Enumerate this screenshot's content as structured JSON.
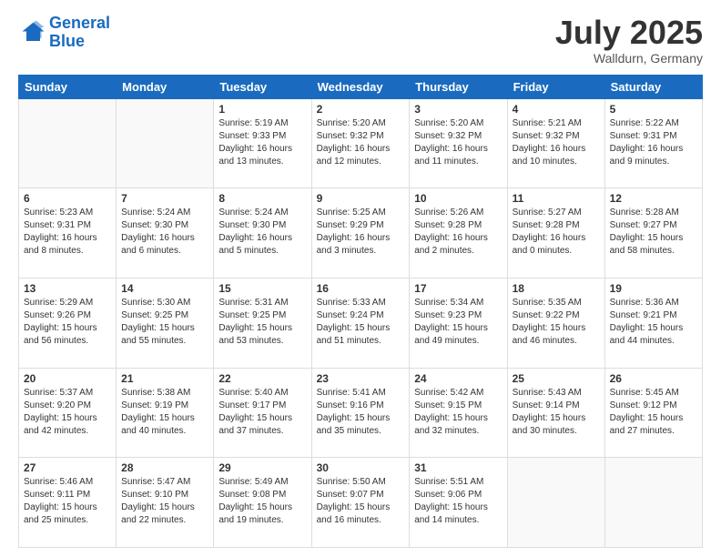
{
  "header": {
    "logo_line1": "General",
    "logo_line2": "Blue",
    "month_year": "July 2025",
    "location": "Walldurn, Germany"
  },
  "weekdays": [
    "Sunday",
    "Monday",
    "Tuesday",
    "Wednesday",
    "Thursday",
    "Friday",
    "Saturday"
  ],
  "weeks": [
    [
      {
        "day": "",
        "info": ""
      },
      {
        "day": "",
        "info": ""
      },
      {
        "day": "1",
        "info": "Sunrise: 5:19 AM\nSunset: 9:33 PM\nDaylight: 16 hours\nand 13 minutes."
      },
      {
        "day": "2",
        "info": "Sunrise: 5:20 AM\nSunset: 9:32 PM\nDaylight: 16 hours\nand 12 minutes."
      },
      {
        "day": "3",
        "info": "Sunrise: 5:20 AM\nSunset: 9:32 PM\nDaylight: 16 hours\nand 11 minutes."
      },
      {
        "day": "4",
        "info": "Sunrise: 5:21 AM\nSunset: 9:32 PM\nDaylight: 16 hours\nand 10 minutes."
      },
      {
        "day": "5",
        "info": "Sunrise: 5:22 AM\nSunset: 9:31 PM\nDaylight: 16 hours\nand 9 minutes."
      }
    ],
    [
      {
        "day": "6",
        "info": "Sunrise: 5:23 AM\nSunset: 9:31 PM\nDaylight: 16 hours\nand 8 minutes."
      },
      {
        "day": "7",
        "info": "Sunrise: 5:24 AM\nSunset: 9:30 PM\nDaylight: 16 hours\nand 6 minutes."
      },
      {
        "day": "8",
        "info": "Sunrise: 5:24 AM\nSunset: 9:30 PM\nDaylight: 16 hours\nand 5 minutes."
      },
      {
        "day": "9",
        "info": "Sunrise: 5:25 AM\nSunset: 9:29 PM\nDaylight: 16 hours\nand 3 minutes."
      },
      {
        "day": "10",
        "info": "Sunrise: 5:26 AM\nSunset: 9:28 PM\nDaylight: 16 hours\nand 2 minutes."
      },
      {
        "day": "11",
        "info": "Sunrise: 5:27 AM\nSunset: 9:28 PM\nDaylight: 16 hours\nand 0 minutes."
      },
      {
        "day": "12",
        "info": "Sunrise: 5:28 AM\nSunset: 9:27 PM\nDaylight: 15 hours\nand 58 minutes."
      }
    ],
    [
      {
        "day": "13",
        "info": "Sunrise: 5:29 AM\nSunset: 9:26 PM\nDaylight: 15 hours\nand 56 minutes."
      },
      {
        "day": "14",
        "info": "Sunrise: 5:30 AM\nSunset: 9:25 PM\nDaylight: 15 hours\nand 55 minutes."
      },
      {
        "day": "15",
        "info": "Sunrise: 5:31 AM\nSunset: 9:25 PM\nDaylight: 15 hours\nand 53 minutes."
      },
      {
        "day": "16",
        "info": "Sunrise: 5:33 AM\nSunset: 9:24 PM\nDaylight: 15 hours\nand 51 minutes."
      },
      {
        "day": "17",
        "info": "Sunrise: 5:34 AM\nSunset: 9:23 PM\nDaylight: 15 hours\nand 49 minutes."
      },
      {
        "day": "18",
        "info": "Sunrise: 5:35 AM\nSunset: 9:22 PM\nDaylight: 15 hours\nand 46 minutes."
      },
      {
        "day": "19",
        "info": "Sunrise: 5:36 AM\nSunset: 9:21 PM\nDaylight: 15 hours\nand 44 minutes."
      }
    ],
    [
      {
        "day": "20",
        "info": "Sunrise: 5:37 AM\nSunset: 9:20 PM\nDaylight: 15 hours\nand 42 minutes."
      },
      {
        "day": "21",
        "info": "Sunrise: 5:38 AM\nSunset: 9:19 PM\nDaylight: 15 hours\nand 40 minutes."
      },
      {
        "day": "22",
        "info": "Sunrise: 5:40 AM\nSunset: 9:17 PM\nDaylight: 15 hours\nand 37 minutes."
      },
      {
        "day": "23",
        "info": "Sunrise: 5:41 AM\nSunset: 9:16 PM\nDaylight: 15 hours\nand 35 minutes."
      },
      {
        "day": "24",
        "info": "Sunrise: 5:42 AM\nSunset: 9:15 PM\nDaylight: 15 hours\nand 32 minutes."
      },
      {
        "day": "25",
        "info": "Sunrise: 5:43 AM\nSunset: 9:14 PM\nDaylight: 15 hours\nand 30 minutes."
      },
      {
        "day": "26",
        "info": "Sunrise: 5:45 AM\nSunset: 9:12 PM\nDaylight: 15 hours\nand 27 minutes."
      }
    ],
    [
      {
        "day": "27",
        "info": "Sunrise: 5:46 AM\nSunset: 9:11 PM\nDaylight: 15 hours\nand 25 minutes."
      },
      {
        "day": "28",
        "info": "Sunrise: 5:47 AM\nSunset: 9:10 PM\nDaylight: 15 hours\nand 22 minutes."
      },
      {
        "day": "29",
        "info": "Sunrise: 5:49 AM\nSunset: 9:08 PM\nDaylight: 15 hours\nand 19 minutes."
      },
      {
        "day": "30",
        "info": "Sunrise: 5:50 AM\nSunset: 9:07 PM\nDaylight: 15 hours\nand 16 minutes."
      },
      {
        "day": "31",
        "info": "Sunrise: 5:51 AM\nSunset: 9:06 PM\nDaylight: 15 hours\nand 14 minutes."
      },
      {
        "day": "",
        "info": ""
      },
      {
        "day": "",
        "info": ""
      }
    ]
  ]
}
